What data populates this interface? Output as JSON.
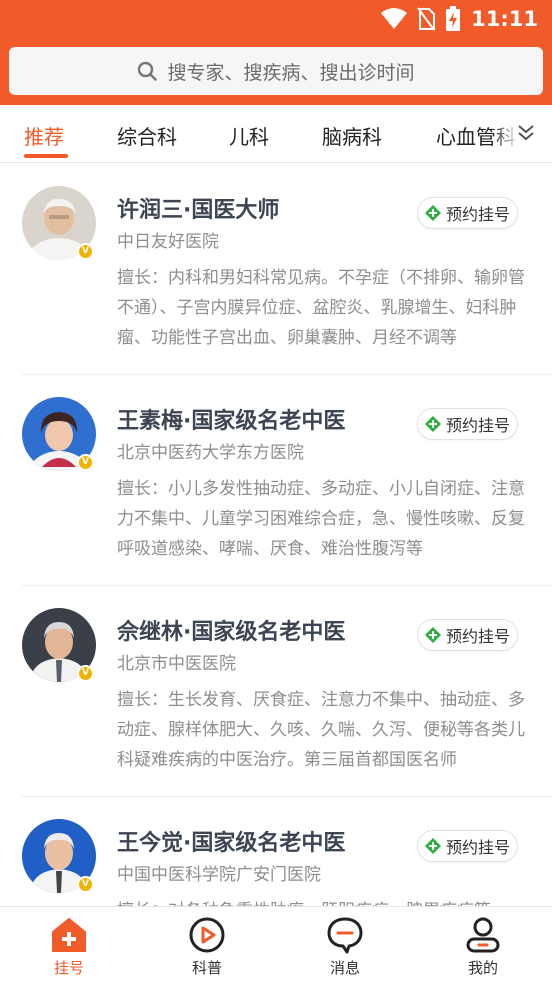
{
  "status_bar": {
    "time": "11:11"
  },
  "search": {
    "placeholder": "搜专家、搜疾病、搜出诊时间"
  },
  "tabs": [
    {
      "label": "推荐",
      "active": true
    },
    {
      "label": "综合科",
      "active": false
    },
    {
      "label": "儿科",
      "active": false
    },
    {
      "label": "脑病科",
      "active": false
    },
    {
      "label": "心血管科",
      "active": false
    }
  ],
  "doctors": [
    {
      "name": "许润三·国医大师",
      "hospital": "中日友好医院",
      "button": "预约挂号",
      "description": "擅长：内科和男妇科常见病。不孕症（不排卵、输卵管不通）、子宫内膜异位症、盆腔炎、乳腺增生、妇科肿瘤、功能性子宫出血、卵巢囊肿、月经不调等"
    },
    {
      "name": "王素梅·国家级名老中医",
      "hospital": "北京中医药大学东方医院",
      "button": "预约挂号",
      "description": "擅长：小儿多发性抽动症、多动症、小儿自闭症、注意力不集中、儿童学习困难综合症，急、慢性咳嗽、反复呼吸道感染、哮喘、厌食、难治性腹泻等"
    },
    {
      "name": "佘继林·国家级名老中医",
      "hospital": "北京市中医医院",
      "button": "预约挂号",
      "description": "擅长：生长发育、厌食症、注意力不集中、抽动症、多动症、腺样体肥大、久咳、久喘、久泻、便秘等各类儿科疑难疾病的中医治疗。第三届首都国医名师"
    },
    {
      "name": "王今觉·国家级名老中医",
      "hospital": "中国中医科学院广安门医院",
      "button": "预约挂号",
      "description": "擅长：对各种急重性肿瘤、肝胆疾病、脾胃疾病等"
    }
  ],
  "bottom_nav": [
    {
      "label": "挂号",
      "icon": "hospital-icon",
      "active": true
    },
    {
      "label": "科普",
      "icon": "play-icon",
      "active": false
    },
    {
      "label": "消息",
      "icon": "message-icon",
      "active": false
    },
    {
      "label": "我的",
      "icon": "user-icon",
      "active": false
    }
  ],
  "colors": {
    "accent": "#f15a29",
    "badge": "#f0b400",
    "book_icon": "#2dae3f"
  }
}
